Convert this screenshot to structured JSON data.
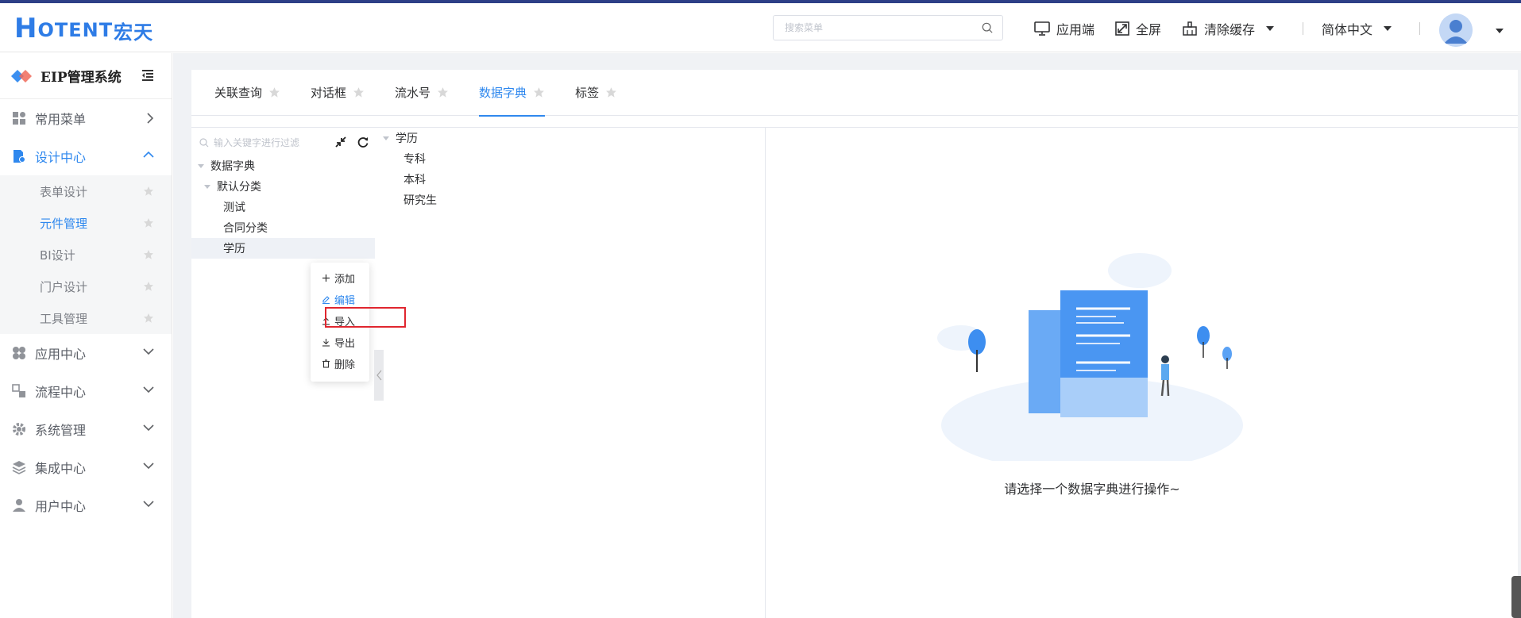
{
  "header": {
    "logo_main": "H",
    "logo_rest": "OTENT",
    "logo_cn": "宏天",
    "search_placeholder": "搜索菜单",
    "app_end": "应用端",
    "fullscreen": "全屏",
    "clear_cache": "清除缓存",
    "language": "简体中文"
  },
  "sidebar": {
    "title": "EIP管理系统",
    "menus": [
      {
        "label": "常用菜单"
      },
      {
        "label": "设计中心"
      },
      {
        "label": "应用中心"
      },
      {
        "label": "流程中心"
      },
      {
        "label": "系统管理"
      },
      {
        "label": "集成中心"
      },
      {
        "label": "用户中心"
      }
    ],
    "sub_items": [
      {
        "label": "表单设计"
      },
      {
        "label": "元件管理"
      },
      {
        "label": "BI设计"
      },
      {
        "label": "门户设计"
      },
      {
        "label": "工具管理"
      }
    ]
  },
  "tabs": [
    {
      "label": "关联查询"
    },
    {
      "label": "对话框"
    },
    {
      "label": "流水号"
    },
    {
      "label": "数据字典"
    },
    {
      "label": "标签"
    }
  ],
  "tree": {
    "filter_placeholder": "输入关键字进行过滤",
    "nodes": [
      {
        "label": "数据字典"
      },
      {
        "label": "默认分类"
      },
      {
        "label": "测试"
      },
      {
        "label": "合同分类"
      },
      {
        "label": "学历"
      }
    ]
  },
  "context_menu": [
    {
      "label": "添加"
    },
    {
      "label": "编辑"
    },
    {
      "label": "导入"
    },
    {
      "label": "导出"
    },
    {
      "label": "删除"
    }
  ],
  "dict_tree": {
    "root": "学历",
    "children": [
      {
        "label": "专科"
      },
      {
        "label": "本科"
      },
      {
        "label": "研究生"
      }
    ]
  },
  "empty_message": "请选择一个数据字典进行操作~",
  "colors": {
    "accent": "#2f88ee",
    "highlight_box": "#e0262f"
  }
}
